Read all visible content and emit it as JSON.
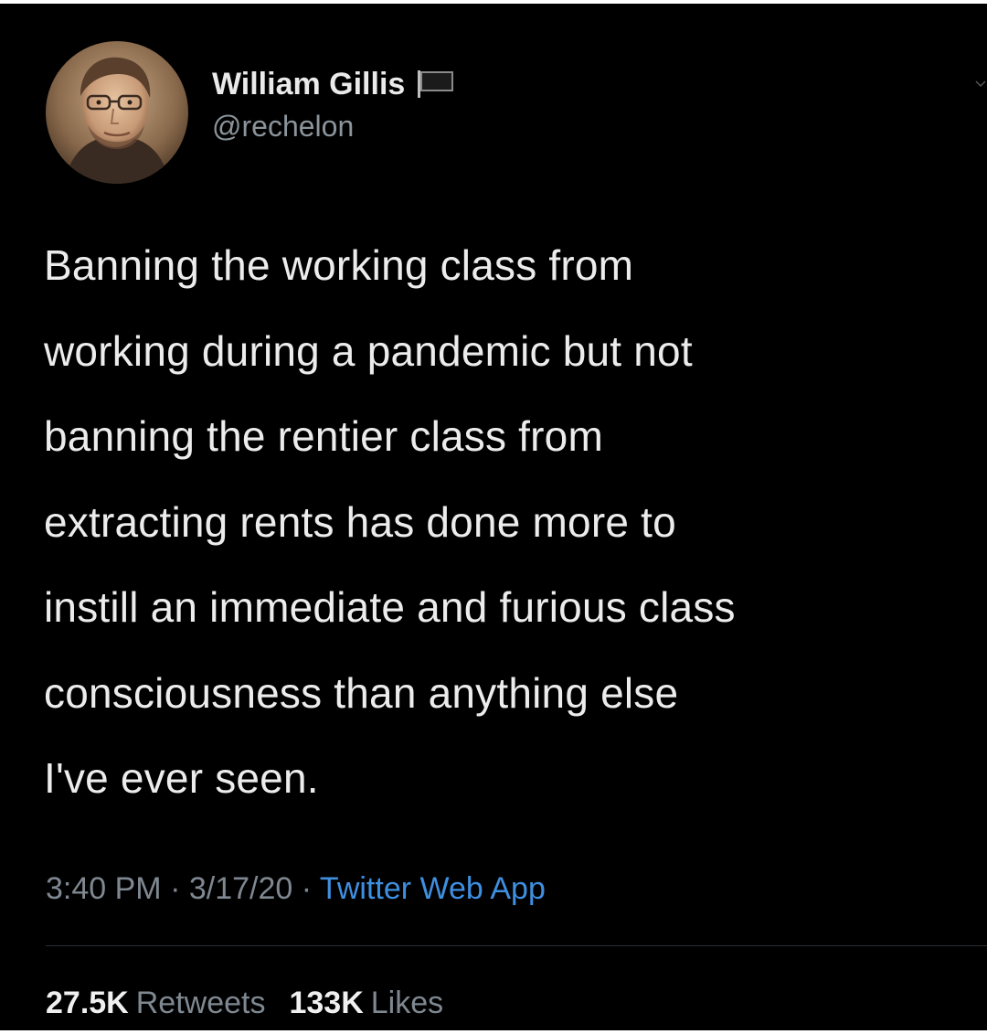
{
  "tweet": {
    "author": {
      "display_name": "William Gillis",
      "handle": "@rechelon",
      "avatar_icon": "user-avatar-photo",
      "badge_icon": "black-flag-icon"
    },
    "text": "Banning the working class from\nworking during a pandemic but not\nbanning the rentier class from\nextracting rents has done more to\ninstill an immediate and furious class\nconsciousness than anything else\nI've ever seen.",
    "time": "3:40 PM",
    "separator": "·",
    "date": "3/17/20",
    "source": "Twitter Web App",
    "retweets_count": "27.5K",
    "retweets_label": "Retweets",
    "likes_count": "133K",
    "likes_label": "Likes"
  },
  "colors": {
    "background": "#000000",
    "text": "#ececec",
    "muted": "#7f8891",
    "link": "#3f8fe0"
  }
}
